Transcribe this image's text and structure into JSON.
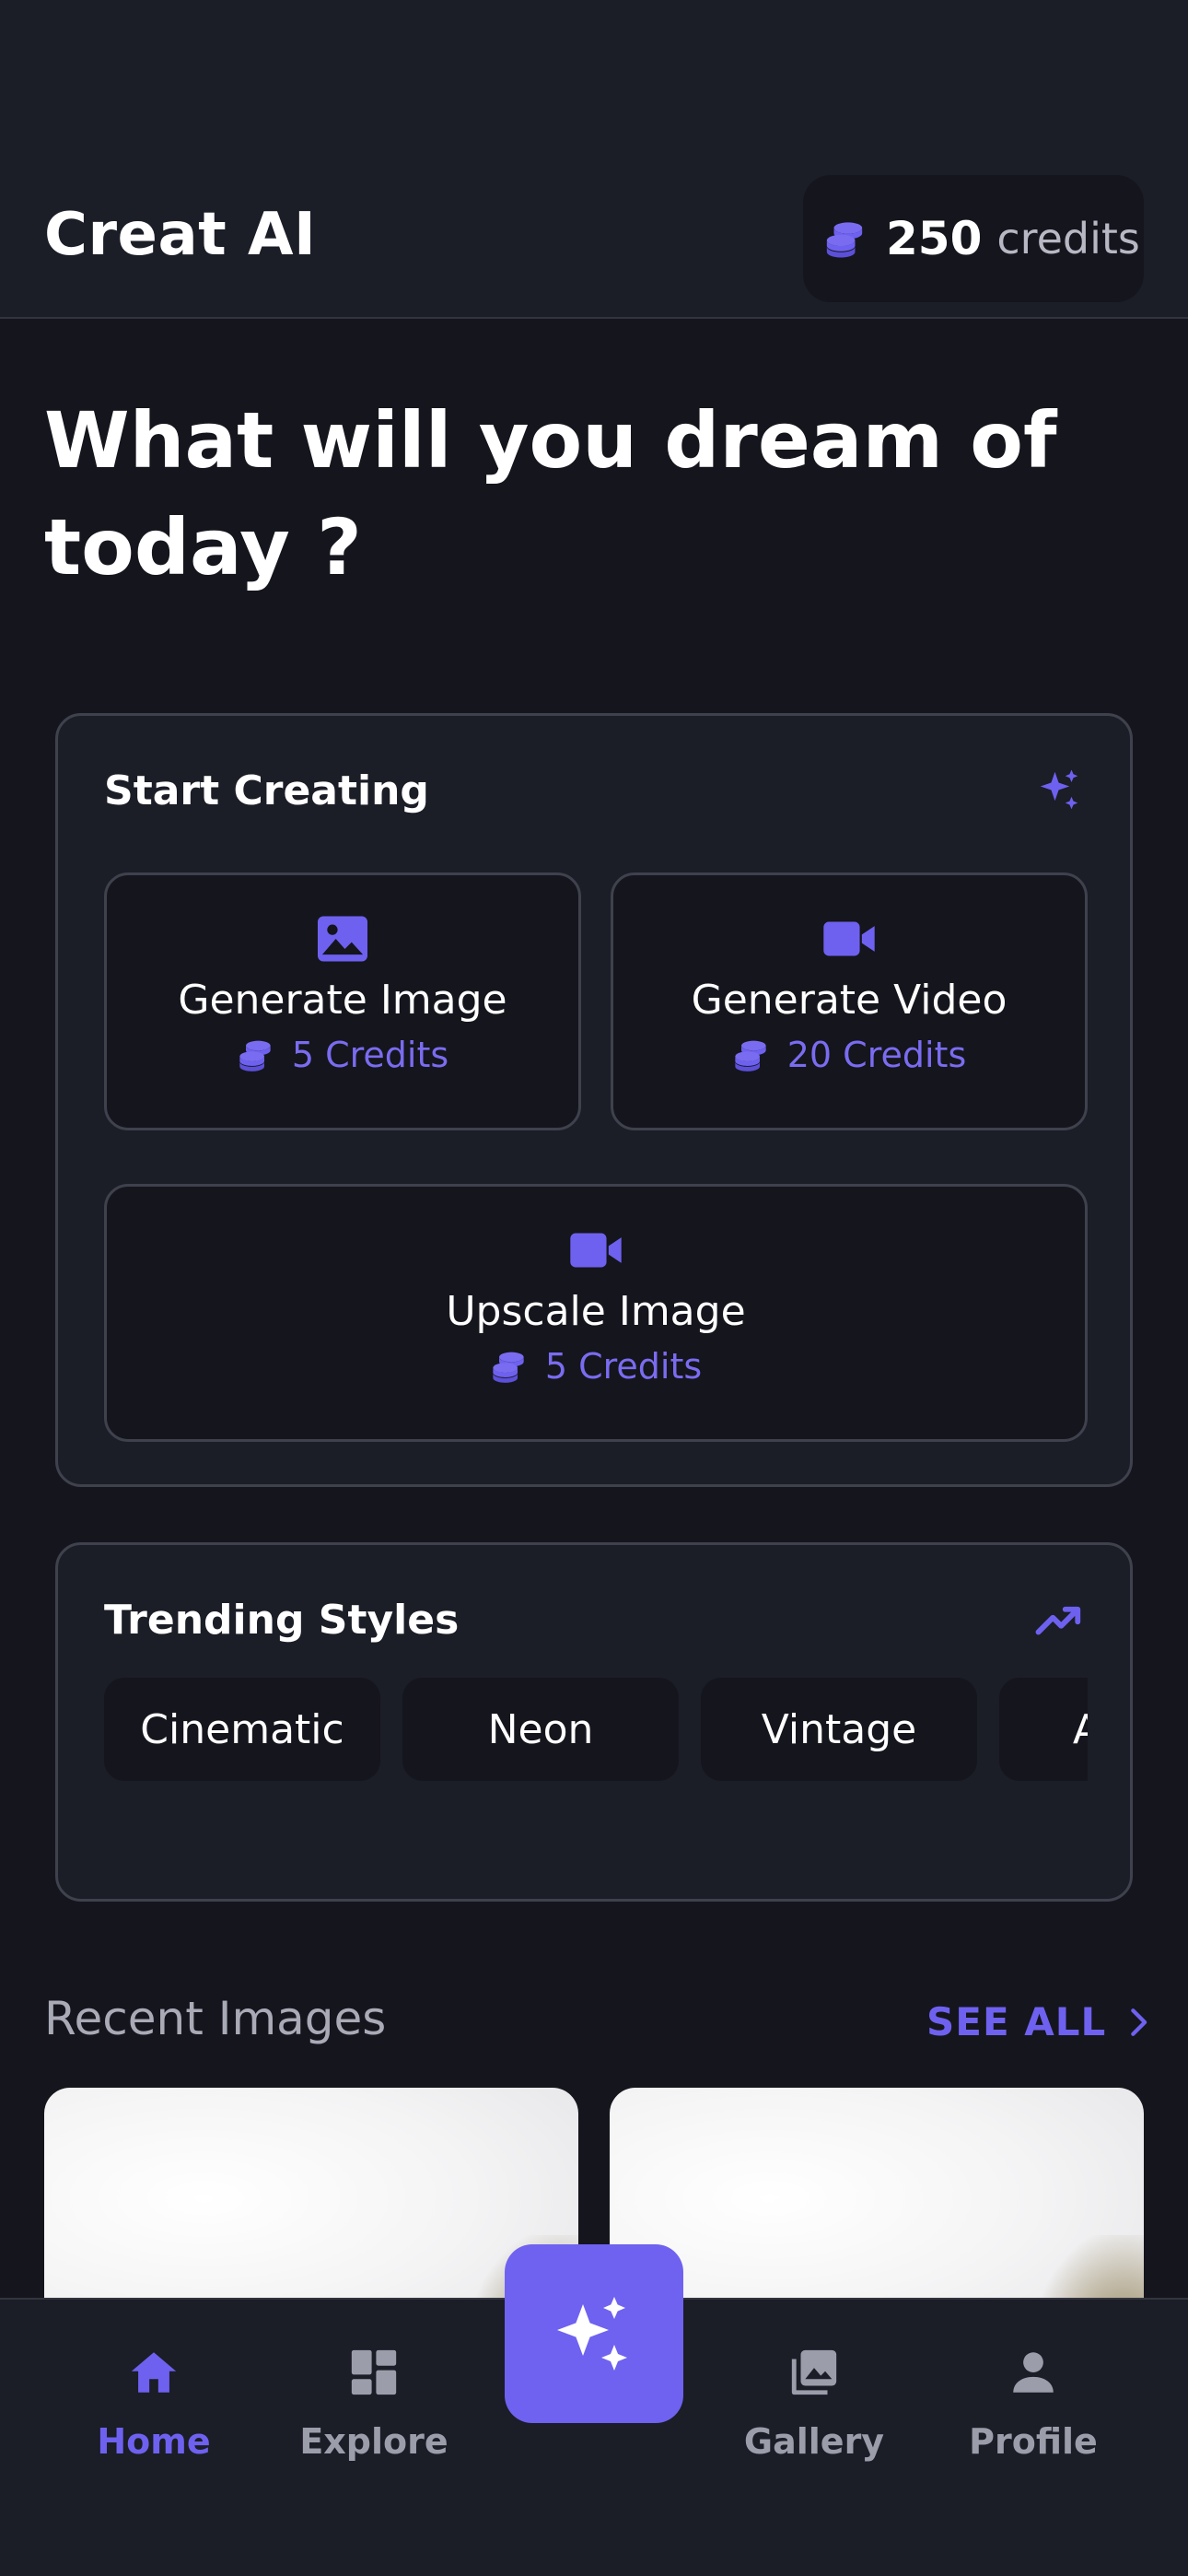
{
  "header": {
    "title": "Creat AI",
    "credits_amount": "250",
    "credits_word": "credits"
  },
  "hero": {
    "headline": "What will you dream of today ?"
  },
  "start_creating": {
    "title": "Start Creating",
    "icon": "sparkles-icon",
    "actions": [
      {
        "label": "Generate Image",
        "cost": "5 Credits",
        "icon": "image-icon"
      },
      {
        "label": "Generate Video",
        "cost": "20 Credits",
        "icon": "video-icon"
      },
      {
        "label": "Upscale Image",
        "cost": "5 Credits",
        "icon": "video-icon"
      }
    ]
  },
  "trending": {
    "title": "Trending Styles",
    "icon": "trending-up-icon",
    "chips": [
      "Cinematic",
      "Neon",
      "Vintage",
      "Anime"
    ]
  },
  "recent": {
    "title": "Recent Images",
    "see_all": "SEE ALL"
  },
  "nav": {
    "home": "Home",
    "explore": "Explore",
    "gallery": "Gallery",
    "profile": "Profile"
  },
  "colors": {
    "accent": "#6e61ef",
    "background": "#15151d",
    "surface": "#1b1d27",
    "border": "#3f414d"
  }
}
